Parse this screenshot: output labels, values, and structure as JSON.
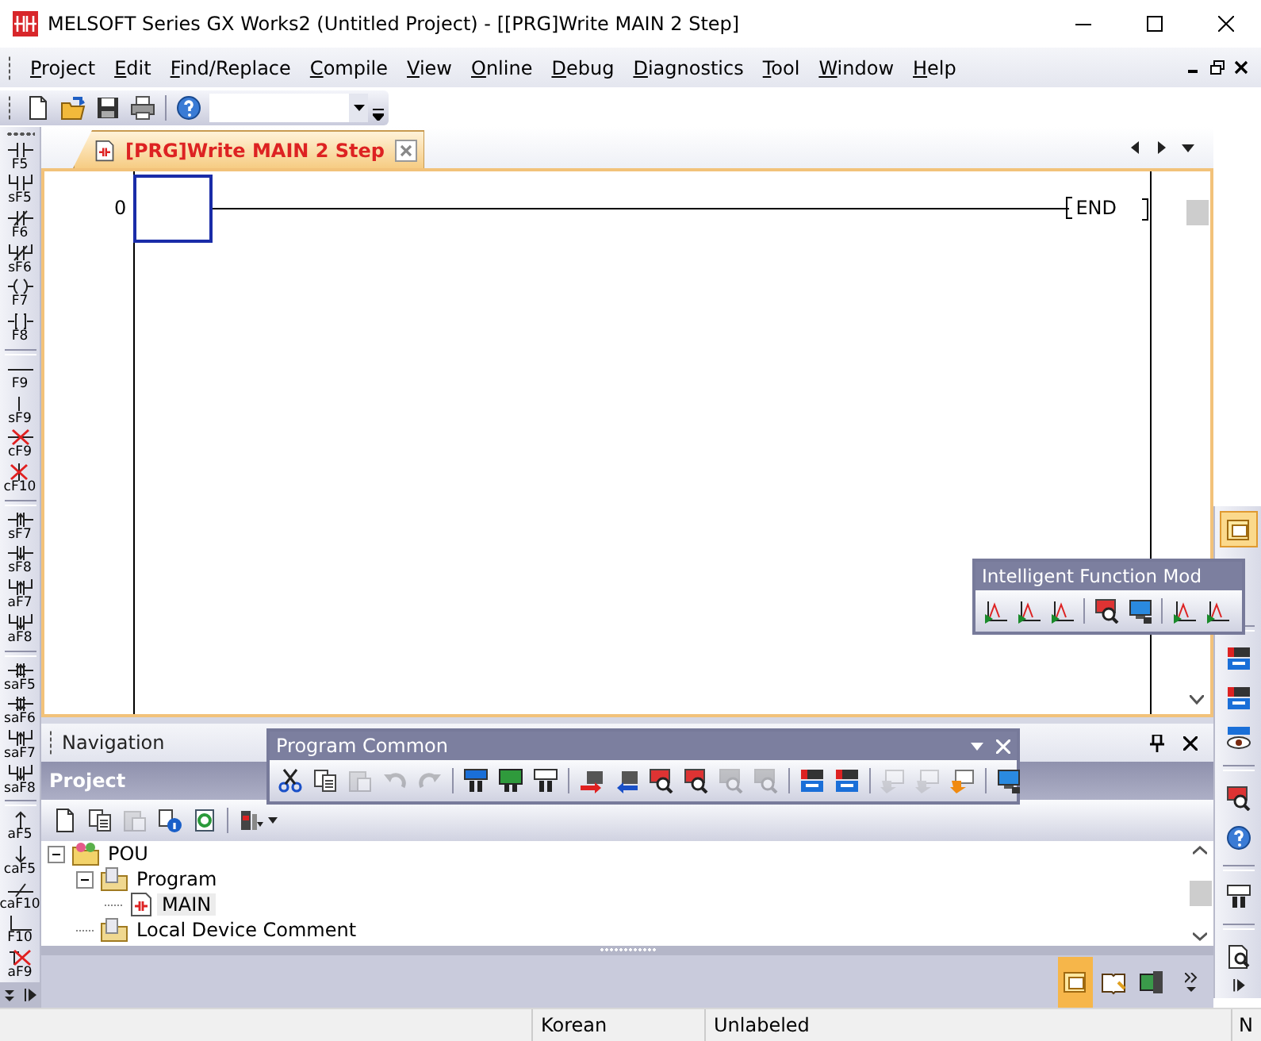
{
  "window": {
    "title": "MELSOFT Series GX Works2 (Untitled Project) - [[PRG]Write MAIN 2 Step]"
  },
  "menu": [
    "Project",
    "Edit",
    "Find/Replace",
    "Compile",
    "View",
    "Online",
    "Debug",
    "Diagnostics",
    "Tool",
    "Window",
    "Help"
  ],
  "standard_toolbar": {
    "buttons": [
      {
        "kind": "new"
      },
      {
        "kind": "open"
      },
      {
        "kind": "save"
      },
      {
        "kind": "print"
      },
      {
        "kind": "sep"
      },
      {
        "kind": "help"
      }
    ]
  },
  "ladder_palette": [
    [
      {
        "label": "F5",
        "kind": "no"
      },
      {
        "label": "sF5",
        "kind": "no-par"
      },
      {
        "label": "F6",
        "kind": "nc"
      },
      {
        "label": "sF6",
        "kind": "nc-par"
      },
      {
        "label": "F7",
        "kind": "coil"
      },
      {
        "label": "F8",
        "kind": "func"
      }
    ],
    [
      {
        "label": "F9",
        "kind": "hline"
      },
      {
        "label": "sF9",
        "kind": "vline"
      },
      {
        "label": "cF9",
        "kind": "del-h"
      },
      {
        "label": "cF10",
        "kind": "del-v"
      }
    ],
    [
      {
        "label": "sF7",
        "kind": "rise"
      },
      {
        "label": "sF8",
        "kind": "fall"
      },
      {
        "label": "aF7",
        "kind": "rise-par"
      },
      {
        "label": "aF8",
        "kind": "fall-par"
      }
    ],
    [
      {
        "label": "saF5",
        "kind": "rise-op"
      },
      {
        "label": "saF6",
        "kind": "fall-op"
      },
      {
        "label": "saF7",
        "kind": "rise-op-par"
      },
      {
        "label": "saF8",
        "kind": "fall-op-par"
      }
    ],
    [
      {
        "label": "aF5",
        "kind": "up"
      },
      {
        "label": "caF5",
        "kind": "down"
      },
      {
        "label": "caF10",
        "kind": "invert"
      },
      {
        "label": "F10",
        "kind": "draw"
      },
      {
        "label": "aF9",
        "kind": "erase"
      }
    ]
  ],
  "tabs": [
    {
      "label": "[PRG]Write MAIN 2 Step",
      "selected": true
    }
  ],
  "ladder": {
    "step": "0",
    "end_instruction": "END"
  },
  "navigation": {
    "title": "Navigation",
    "section": "Project",
    "toolbar": [
      {
        "kind": "new",
        "disabled": false
      },
      {
        "kind": "copy",
        "disabled": false
      },
      {
        "kind": "paste",
        "disabled": true
      },
      {
        "kind": "info",
        "disabled": false
      },
      {
        "kind": "refresh",
        "disabled": false
      },
      {
        "kind": "sep",
        "disabled": false
      },
      {
        "kind": "tool",
        "disabled": false
      }
    ],
    "tree": [
      {
        "label": "POU",
        "kind": "pou",
        "expanded": true,
        "selected": false,
        "children": [
          {
            "label": "Program",
            "kind": "folder",
            "expanded": true,
            "selected": false,
            "children": [
              {
                "label": "MAIN",
                "kind": "program",
                "selected": true
              }
            ]
          },
          {
            "label": "Local Device Comment",
            "kind": "folder",
            "selected": false
          }
        ]
      }
    ],
    "views": [
      {
        "kind": "project",
        "selected": true
      },
      {
        "kind": "book",
        "selected": false
      },
      {
        "kind": "module",
        "selected": false
      }
    ]
  },
  "program_common": {
    "title": "Program Common",
    "buttons": [
      {
        "kind": "cut",
        "disabled": false
      },
      {
        "kind": "copy",
        "disabled": false
      },
      {
        "kind": "paste",
        "disabled": true
      },
      {
        "kind": "undo",
        "disabled": true
      },
      {
        "kind": "redo",
        "disabled": true
      },
      {
        "kind": "sep",
        "disabled": false
      },
      {
        "kind": "find",
        "disabled": false
      },
      {
        "kind": "find-screen",
        "disabled": false
      },
      {
        "kind": "find-contact",
        "disabled": false
      },
      {
        "kind": "sep",
        "disabled": false
      },
      {
        "kind": "arrow-right",
        "disabled": false
      },
      {
        "kind": "arrow-left",
        "disabled": false
      },
      {
        "kind": "module-search",
        "disabled": false
      },
      {
        "kind": "module-search",
        "disabled": false
      },
      {
        "kind": "module-search",
        "disabled": true
      },
      {
        "kind": "module-search",
        "disabled": true
      },
      {
        "kind": "sep",
        "disabled": false
      },
      {
        "kind": "dev-read",
        "disabled": false
      },
      {
        "kind": "dev-write",
        "disabled": false
      },
      {
        "kind": "sep",
        "disabled": false
      },
      {
        "kind": "comment",
        "disabled": true
      },
      {
        "kind": "comment",
        "disabled": true
      },
      {
        "kind": "comment",
        "disabled": false
      },
      {
        "kind": "sep",
        "disabled": false
      },
      {
        "kind": "monitor",
        "disabled": false
      }
    ]
  },
  "intelligent_function": {
    "title": "Intelligent Function Mod",
    "buttons": [
      {
        "kind": "graph",
        "disabled": false
      },
      {
        "kind": "graph",
        "disabled": false
      },
      {
        "kind": "graph",
        "disabled": false
      },
      {
        "kind": "sep",
        "disabled": false
      },
      {
        "kind": "module-search",
        "disabled": false
      },
      {
        "kind": "monitor",
        "disabled": false
      },
      {
        "kind": "sep",
        "disabled": false
      },
      {
        "kind": "graph",
        "disabled": false
      },
      {
        "kind": "graph",
        "disabled": false
      }
    ]
  },
  "right_palette": [
    {
      "kind": "project",
      "selected": true
    },
    {
      "kind": "dev-read",
      "selected": false
    },
    {
      "kind": "dev-write",
      "selected": false
    },
    {
      "kind": "eye",
      "selected": false
    },
    {
      "kind": "module-search",
      "selected": false
    },
    {
      "kind": "help",
      "selected": false
    },
    {
      "kind": "find-contact",
      "selected": false
    },
    {
      "kind": "page-search",
      "selected": false
    }
  ],
  "status_bar": [
    "Korean",
    "Unlabeled",
    "N"
  ]
}
